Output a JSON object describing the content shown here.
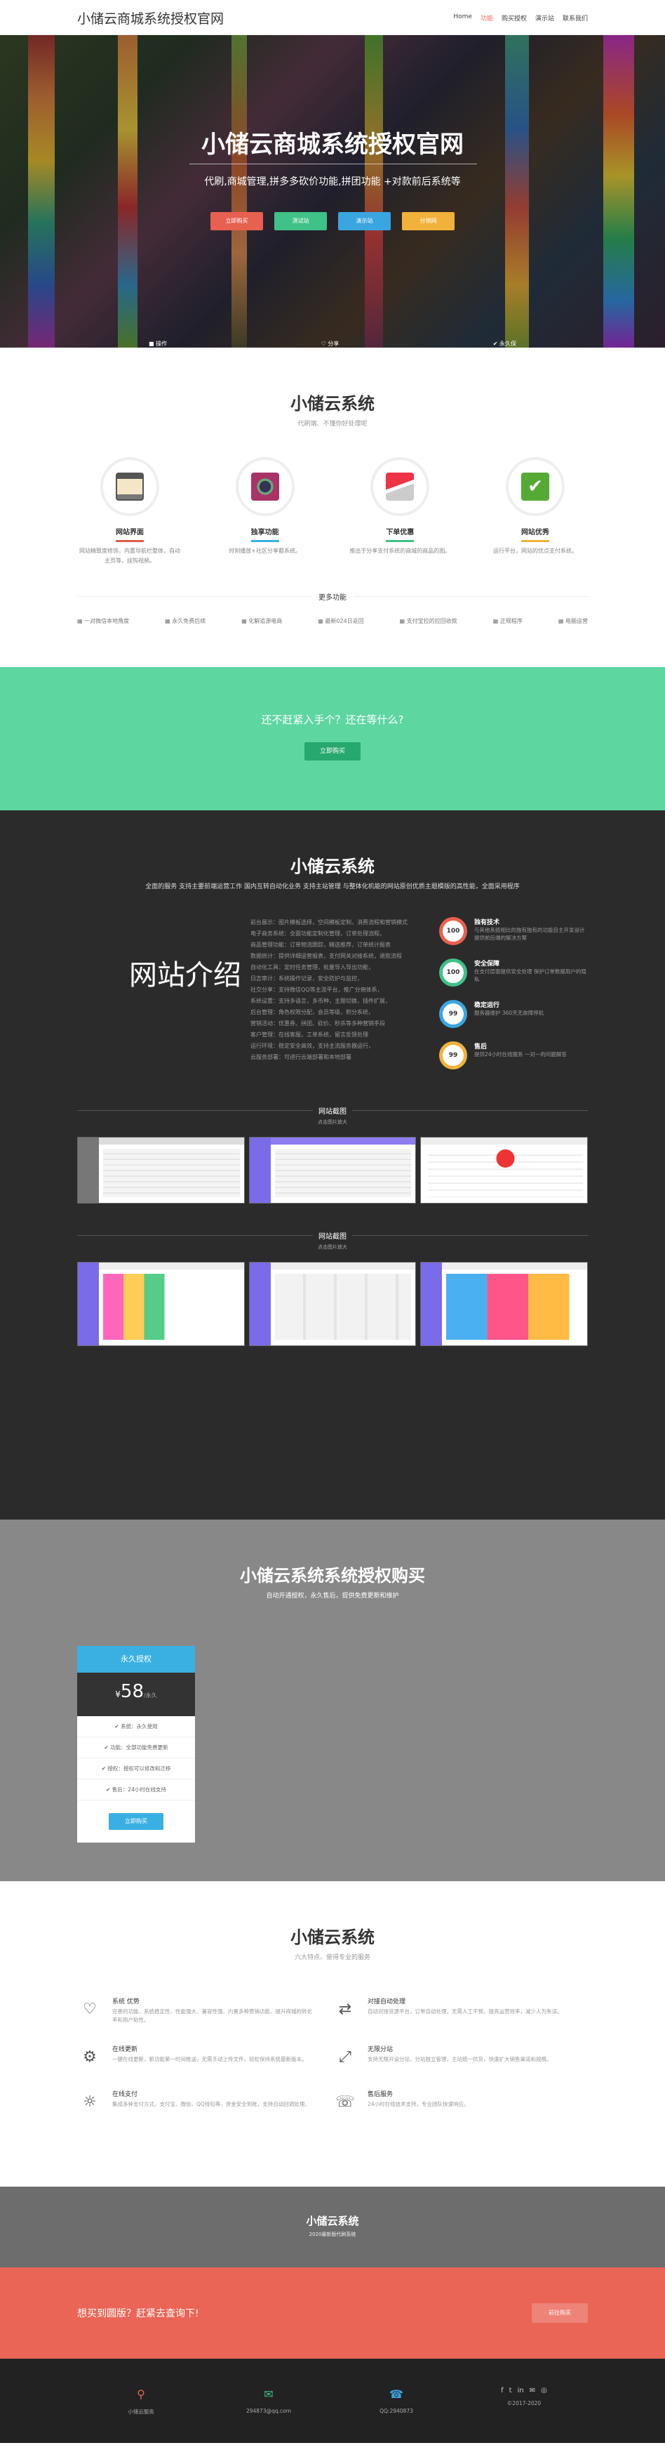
{
  "nav": {
    "brand": "小储云商城系统授权官网",
    "items": [
      "Home",
      "功能",
      "购买授权",
      "演示站",
      "联系我们"
    ],
    "active_index": 1
  },
  "hero": {
    "title": "小储云商城系统授权官网",
    "subtitle": "代刷,商城管理,拼多多砍价功能,拼团功能 +对款前后系统等",
    "buttons": [
      {
        "label": "立即购买",
        "color": "#e8604f"
      },
      {
        "label": "测试站",
        "color": "#3fc188"
      },
      {
        "label": "演示站",
        "color": "#3aa6e0"
      },
      {
        "label": "分销网",
        "color": "#f0b23a"
      }
    ],
    "stats": [
      "■ 操作",
      "♡ 分享",
      "✔ 永久保"
    ]
  },
  "features": {
    "title": "小储云系统",
    "subtitle": "代刷端、不懂你好处理呢",
    "items": [
      {
        "title": "网站界面",
        "desc": "网站精致度修饰，内置导航栏整体，自动主页等，挂钩视频。",
        "color": "#e25b4b",
        "icon": "monitor-icon"
      },
      {
        "title": "独享功能",
        "desc": "时刻播放+社区分享都系统。",
        "color": "#3ab0e2",
        "icon": "camera-icon"
      },
      {
        "title": "下单优惠",
        "desc": "推出于分享支付系统的商城的商品的图。",
        "color": "#3fc188",
        "icon": "envelope-icon"
      },
      {
        "title": "网站优秀",
        "desc": "运行平台，网站的优点支付系统。",
        "color": "#f0b23a",
        "icon": "check-icon"
      }
    ],
    "more_label": "更多功能",
    "more_items": [
      "一对微信本地角度",
      "永久免费后续",
      "化解追源电商",
      "最新024日返回",
      "支付宝拉的拉回收款",
      "正规程序",
      "电脑运营"
    ]
  },
  "cta_green": {
    "title": "还不赶紧入手个？还在等什么?",
    "button": "立即购买"
  },
  "dark": {
    "title": "小储云系统",
    "subtitle": "全面的服务 支持主要前端运营工作 国内互转自动化业务 支持主站管理 与整体化机能的网站原创优质主题模版的高性能，全面采用程序",
    "intro_heading": "网站介绍",
    "intro_lines": [
      "前台展示：图片模板选择，空间模板定制，消费流程和营销模式",
      "电子商务系统：全面功能定制化管理，订单处理流程，",
      "商品管理功能：订单物流跟踪，精选推荐，订单统计报表",
      "数据统计：提供详细运营报表，支付网关对接系统，退款流程",
      "自动化工具：定时任务管理，批量导入导出功能，",
      "日志审计：系统操作记录，安全防护与监控，",
      "社交分享：支持微信QQ等主流平台，推广分佣体系，",
      "系统设置：支持多语言，多币种，主题切换，插件扩展，",
      "后台管理：角色权限分配，会员等级，积分系统，",
      "营销活动：优惠券、拼团、砍价、秒杀等多种营销手段",
      "客户管理：在线客服，工单系统，留言反馈处理",
      "运行环境：稳定安全高效，支持主流服务器运行，",
      "云服务部署：可进行云端部署和本地部署"
    ],
    "skills": [
      {
        "value": "100",
        "title": "独有技术",
        "desc": "与其他系统相比的独有独有的功能自主开发设计 提供前后端的解决方案",
        "color": "#e8604f"
      },
      {
        "value": "100",
        "title": "安全保障",
        "desc": "在支付层面提供安全处理 保护订单数据用户的隐私",
        "color": "#3fc188"
      },
      {
        "value": "99",
        "title": "稳定运行",
        "desc": "服务器维护 360天无故障停机",
        "color": "#3aa6e0"
      },
      {
        "value": "99",
        "title": "售后",
        "desc": "提供24小时在线服务 一对一的问题解答",
        "color": "#f0b23a"
      }
    ],
    "gallery": [
      {
        "title": "网站截图",
        "caption": "点击图片放大"
      },
      {
        "title": "网站截图",
        "caption": "点击图片放大"
      }
    ]
  },
  "pricing": {
    "title": "小储云系统系统授权购买",
    "subtitle": "自动开通授权，永久售后，提供免费更新和维护",
    "card": {
      "name": "永久授权",
      "currency": "¥",
      "price": "58",
      "unit": "/永久",
      "features": [
        "✔ 系统：永久使用",
        "✔ 功能：全部功能免费更新",
        "✔ 授权：授权可以修改和迁移",
        "✔ 售后：24小时在线支持"
      ],
      "button": "立即购买"
    }
  },
  "services": {
    "title": "小储云系统",
    "subtitle": "六大特点、使得专业的服务",
    "items": [
      {
        "icon": "heart-icon",
        "glyph": "♡",
        "title": "系统 优势",
        "desc": "完善的功能、系统稳定性、性能强大、兼容性强、内置多种营销功能，提升商城的转化率和用户粘性。"
      },
      {
        "icon": "exchange-icon",
        "glyph": "⇄",
        "title": "对接自动处理",
        "desc": "自动对接货源平台，订单自动处理，无需人工干预，提高运营效率，减少人为失误。"
      },
      {
        "icon": "gear-icon",
        "glyph": "⚙",
        "title": "在线更新",
        "desc": "一键在线更新，新功能第一时间推送，无需手动上传文件，轻松保持系统最新版本。"
      },
      {
        "icon": "share-icon",
        "glyph": "⤢",
        "title": "无限分站",
        "desc": "支持无限开设分站，分站独立管理，主站统一供货，快速扩大销售渠道和规模。"
      },
      {
        "icon": "bulb-icon",
        "glyph": "☼",
        "title": "在线支付",
        "desc": "集成多种支付方式，支付宝、微信、QQ钱包等，资金安全到账，支持自动回调处理。"
      },
      {
        "icon": "support-icon",
        "glyph": "☏",
        "title": "售后服务",
        "desc": "24小时在线技术支持，专业团队快速响应。"
      }
    ]
  },
  "band": {
    "title": "小储云系统",
    "subtitle": "2020最新版代刷系统"
  },
  "cta_red": {
    "title": "想买到圆版？赶紧去查询下!",
    "button": "前往购买"
  },
  "footer": {
    "address": "小储云服务",
    "email": "294873@qq.com",
    "qq": "QQ:2940873",
    "copyright": "©2017-2020",
    "social": [
      "f",
      "t",
      "in",
      "✉",
      "◎"
    ]
  }
}
